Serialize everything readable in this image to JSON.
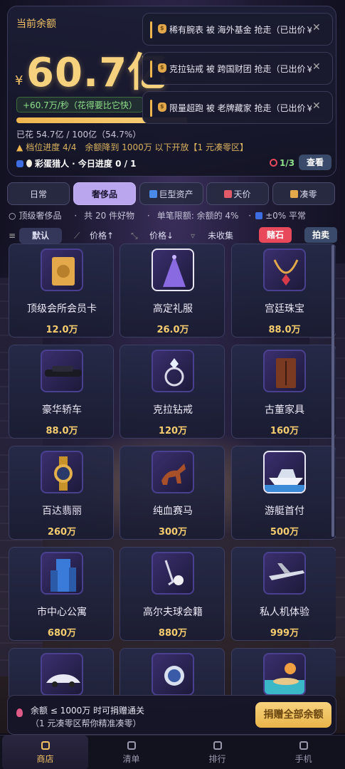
{
  "header": {
    "balance_label": "当前余额",
    "currency": "¥",
    "amount": "60.7亿",
    "rate": "+60.7万/秒（花得要比它快）",
    "spent_progress": 0.547,
    "spent_text": "已花 54.7亿 / 100亿（54.7%）",
    "tier_text": "档位进度 4/4　余额降到 1000万 以下开放【1 元凑零区】",
    "hunter_text": "彩蛋猎人 · 今日进度 0 / 1",
    "target_text": "1/3",
    "view_label": "查看"
  },
  "notifications": [
    "稀有腕表 被 海外基金 抢走（已出价￥",
    "克拉钻戒 被 跨国财团 抢走（已出价￥",
    "限量超跑 被 老牌藏家 抢走（已出价￥"
  ],
  "tabs": [
    {
      "label": "日常",
      "active": false
    },
    {
      "label": "奢侈品",
      "active": true
    },
    {
      "label": "巨型资产",
      "active": false,
      "icon": "chart-icon"
    },
    {
      "label": "天价",
      "active": false,
      "icon": "trend-icon"
    },
    {
      "label": "凑零",
      "active": false,
      "icon": "lock-icon"
    }
  ],
  "info": {
    "category": "顶级奢侈品",
    "count": "共 20 件好物",
    "limit": "单笔限额: 余额的 4%",
    "change": "±0% 平常"
  },
  "sort": {
    "default": "默认",
    "price_up": "价格↑",
    "price_down": "价格↓",
    "uncollected": "未收集",
    "gamble": "赌石",
    "auction": "拍卖"
  },
  "items": [
    {
      "name": "顶级会所会员卡",
      "price": "12.0万",
      "icon": "gold-card-icon"
    },
    {
      "name": "高定礼服",
      "price": "26.0万",
      "icon": "gown-icon"
    },
    {
      "name": "宫廷珠宝",
      "price": "88.0万",
      "icon": "necklace-icon"
    },
    {
      "name": "豪华轿车",
      "price": "88.0万",
      "icon": "limousine-icon"
    },
    {
      "name": "克拉钻戒",
      "price": "120万",
      "icon": "diamond-ring-icon"
    },
    {
      "name": "古董家具",
      "price": "160万",
      "icon": "cabinet-icon"
    },
    {
      "name": "百达翡丽",
      "price": "260万",
      "icon": "gold-watch-icon"
    },
    {
      "name": "纯血赛马",
      "price": "300万",
      "icon": "horse-icon"
    },
    {
      "name": "游艇首付",
      "price": "500万",
      "icon": "yacht-icon"
    },
    {
      "name": "市中心公寓",
      "price": "680万",
      "icon": "tower-icon"
    },
    {
      "name": "高尔夫球会籍",
      "price": "880万",
      "icon": "golf-icon"
    },
    {
      "name": "私人机体验",
      "price": "999万",
      "icon": "jet-icon"
    },
    {
      "name": "",
      "price": "",
      "icon": "supercar-icon"
    },
    {
      "name": "",
      "price": "",
      "icon": "diamond-watch-icon"
    },
    {
      "name": "",
      "price": "",
      "icon": "island-icon"
    }
  ],
  "donate": {
    "line1": "余额 ≤ 1000万 时可捐赠通关",
    "line2": "（1 元凑零区帮你精准凑零）",
    "button": "捐赠全部余额"
  },
  "nav": [
    {
      "label": "商店",
      "active": true,
      "icon": "bag-icon"
    },
    {
      "label": "清单",
      "active": false,
      "icon": "list-icon"
    },
    {
      "label": "排行",
      "active": false,
      "icon": "trophy-icon"
    },
    {
      "label": "手机",
      "active": false,
      "icon": "phone-icon"
    }
  ],
  "colors": {
    "gold": "#f7d27e",
    "accent": "#b9a6ef",
    "gamble": "#e8495b",
    "auction": "#3a4a6a"
  }
}
